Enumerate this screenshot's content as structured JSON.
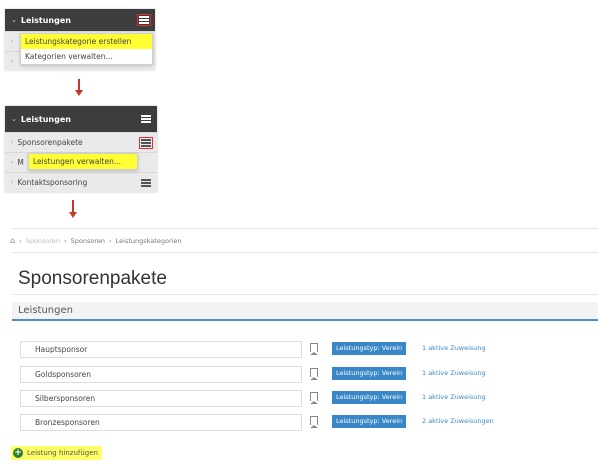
{
  "step1": {
    "header_title": "Leistungen",
    "menu_items": [
      "Leistungskategorie erstellen",
      "Kategorien verwalten..."
    ]
  },
  "step2": {
    "header_title": "Leistungen",
    "rows": [
      "Sponsorenpakete",
      "M",
      "Kontaktsponsoring"
    ],
    "menu_item": "Leistungen verwalten..."
  },
  "breadcrumb": [
    "Sponsoren",
    "Sponsoren",
    "Leistungskategorien"
  ],
  "page_title": "Sponsorenpakete",
  "section_title": "Leistungen",
  "items": [
    {
      "name": "Hauptsponsor",
      "badge": "Leistungstyp: Verein",
      "link": "1 aktive Zuweisung"
    },
    {
      "name": "Goldsponsoren",
      "badge": "Leistungstyp: Verein",
      "link": "1 aktive Zuweisung"
    },
    {
      "name": "Silbersponsoren",
      "badge": "Leistungstyp: Verein",
      "link": "1 aktive Zuweisung"
    },
    {
      "name": "Bronzesponsoren",
      "badge": "Leistungstyp: Verein",
      "link": "2 aktive Zuweisungen"
    }
  ],
  "add_label": "Leistung hinzufügen",
  "colors": {
    "header_dark": "#3d3d3d",
    "highlight_yellow": "#ffff33",
    "highlight_red": "#e0303a",
    "accent_blue": "#3a87c8",
    "add_green": "#2e7d32"
  }
}
